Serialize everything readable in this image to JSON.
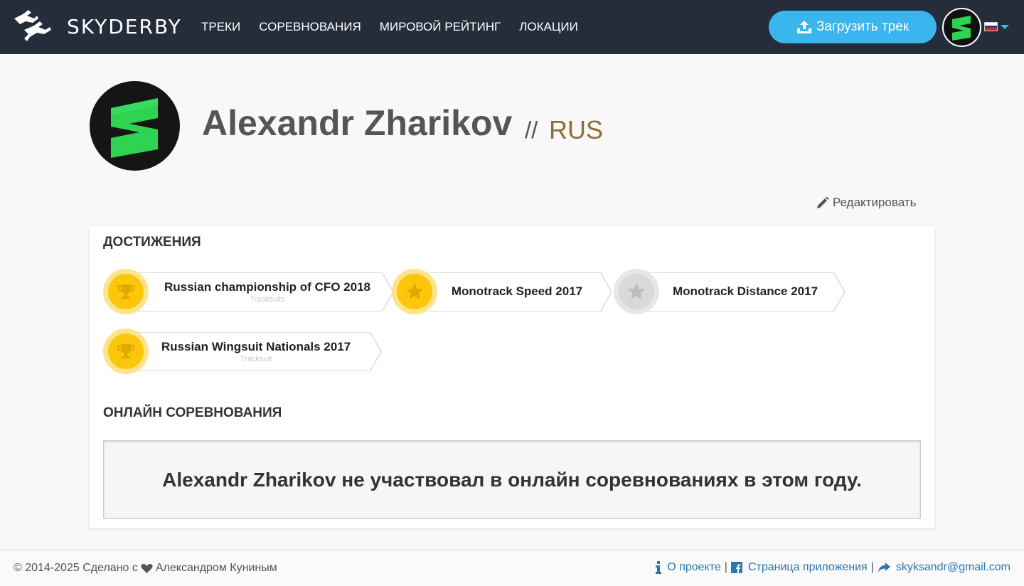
{
  "navbar": {
    "brand": "SKYDERBY",
    "links": [
      "ТРЕКИ",
      "СОРЕВНОВАНИЯ",
      "МИРОВОЙ РЕЙТИНГ",
      "ЛОКАЦИИ"
    ],
    "upload_label": "Загрузить трек",
    "language": "ru",
    "accent_color": "#3bb5ee",
    "background_color": "#252d3b"
  },
  "profile": {
    "name": "Alexandr Zharikov",
    "separator": "//",
    "country": "RUS",
    "edit_label": "Редактировать"
  },
  "achievements": {
    "title": "ДОСТИЖЕНИЯ",
    "items": [
      {
        "title": "Russian championship of CFO 2018",
        "subtitle": "Tracksuits",
        "medal": "gold",
        "icon": "trophy-icon"
      },
      {
        "title": "Monotrack Speed 2017",
        "subtitle": "",
        "medal": "gold",
        "icon": "star-icon"
      },
      {
        "title": "Monotrack Distance 2017",
        "subtitle": "",
        "medal": "silver",
        "icon": "star-icon"
      },
      {
        "title": "Russian Wingsuit Nationals 2017",
        "subtitle": "Tracksuit",
        "medal": "gold",
        "icon": "trophy-icon"
      }
    ]
  },
  "online": {
    "title": "ОНЛАЙН СОРЕВНОВАНИЯ",
    "message": "Alexandr Zharikov не участвовал в онлайн соревнованиях в этом году."
  },
  "footer": {
    "copyright_before": "© 2014-2025 Сделано с",
    "copyright_after": "Александром Куниным",
    "about": "О проекте",
    "app_page": "Страница приложения",
    "email": "skyksandr@gmail.com",
    "separator": "|"
  }
}
